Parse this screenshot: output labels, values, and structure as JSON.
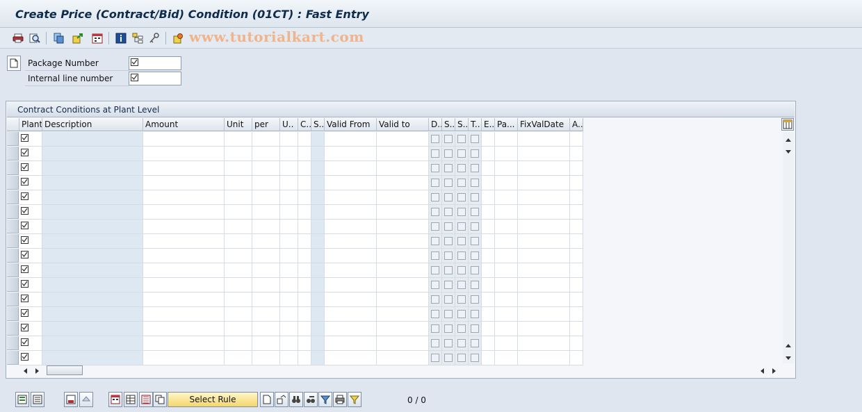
{
  "window": {
    "title": "Create Price (Contract/Bid) Condition (01CT) : Fast Entry",
    "watermark": "www.tutorialkart.com"
  },
  "toolbar": {
    "icons": [
      "print-icon",
      "find-icon",
      "copy-icon",
      "export-icon",
      "calendar-icon",
      "info-icon",
      "structure-icon",
      "key-icon",
      "settings-icon"
    ]
  },
  "header_fields": [
    {
      "label": "Package Number",
      "value": "☑"
    },
    {
      "label": "Internal line number",
      "value": "☑"
    }
  ],
  "panel": {
    "title": "Contract Conditions at Plant Level"
  },
  "table": {
    "columns": [
      "Plant",
      "Description",
      "Amount",
      "Unit",
      "per",
      "U..",
      "C..",
      "S..",
      "Valid From",
      "Valid to",
      "D..",
      "S..",
      "S..",
      "T..",
      "E..",
      "Pa...",
      "FixValDate",
      "A.."
    ],
    "row_count": 16
  },
  "bottom": {
    "select_rule_label": "Select Rule",
    "counter": "0  /  0"
  },
  "colors": {
    "background": "#dfe6ef",
    "title_text": "#0f2c4d",
    "readonly_cell": "#dde8f2",
    "watermark": "#f0b48c"
  }
}
